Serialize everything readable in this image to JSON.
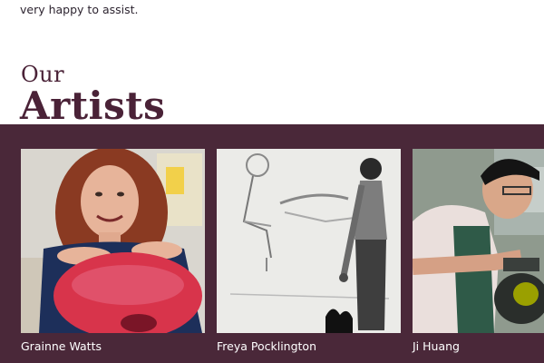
{
  "intro": {
    "text": "very happy to assist."
  },
  "section": {
    "heading_small": "Our",
    "heading_large": "Artists"
  },
  "artists": [
    {
      "name": "Grainne Watts"
    },
    {
      "name": "Freya Pocklington"
    },
    {
      "name": "Ji Huang"
    }
  ],
  "colors": {
    "band": "#4a2839",
    "heading": "#4a2237",
    "name_text": "#ffffff"
  }
}
